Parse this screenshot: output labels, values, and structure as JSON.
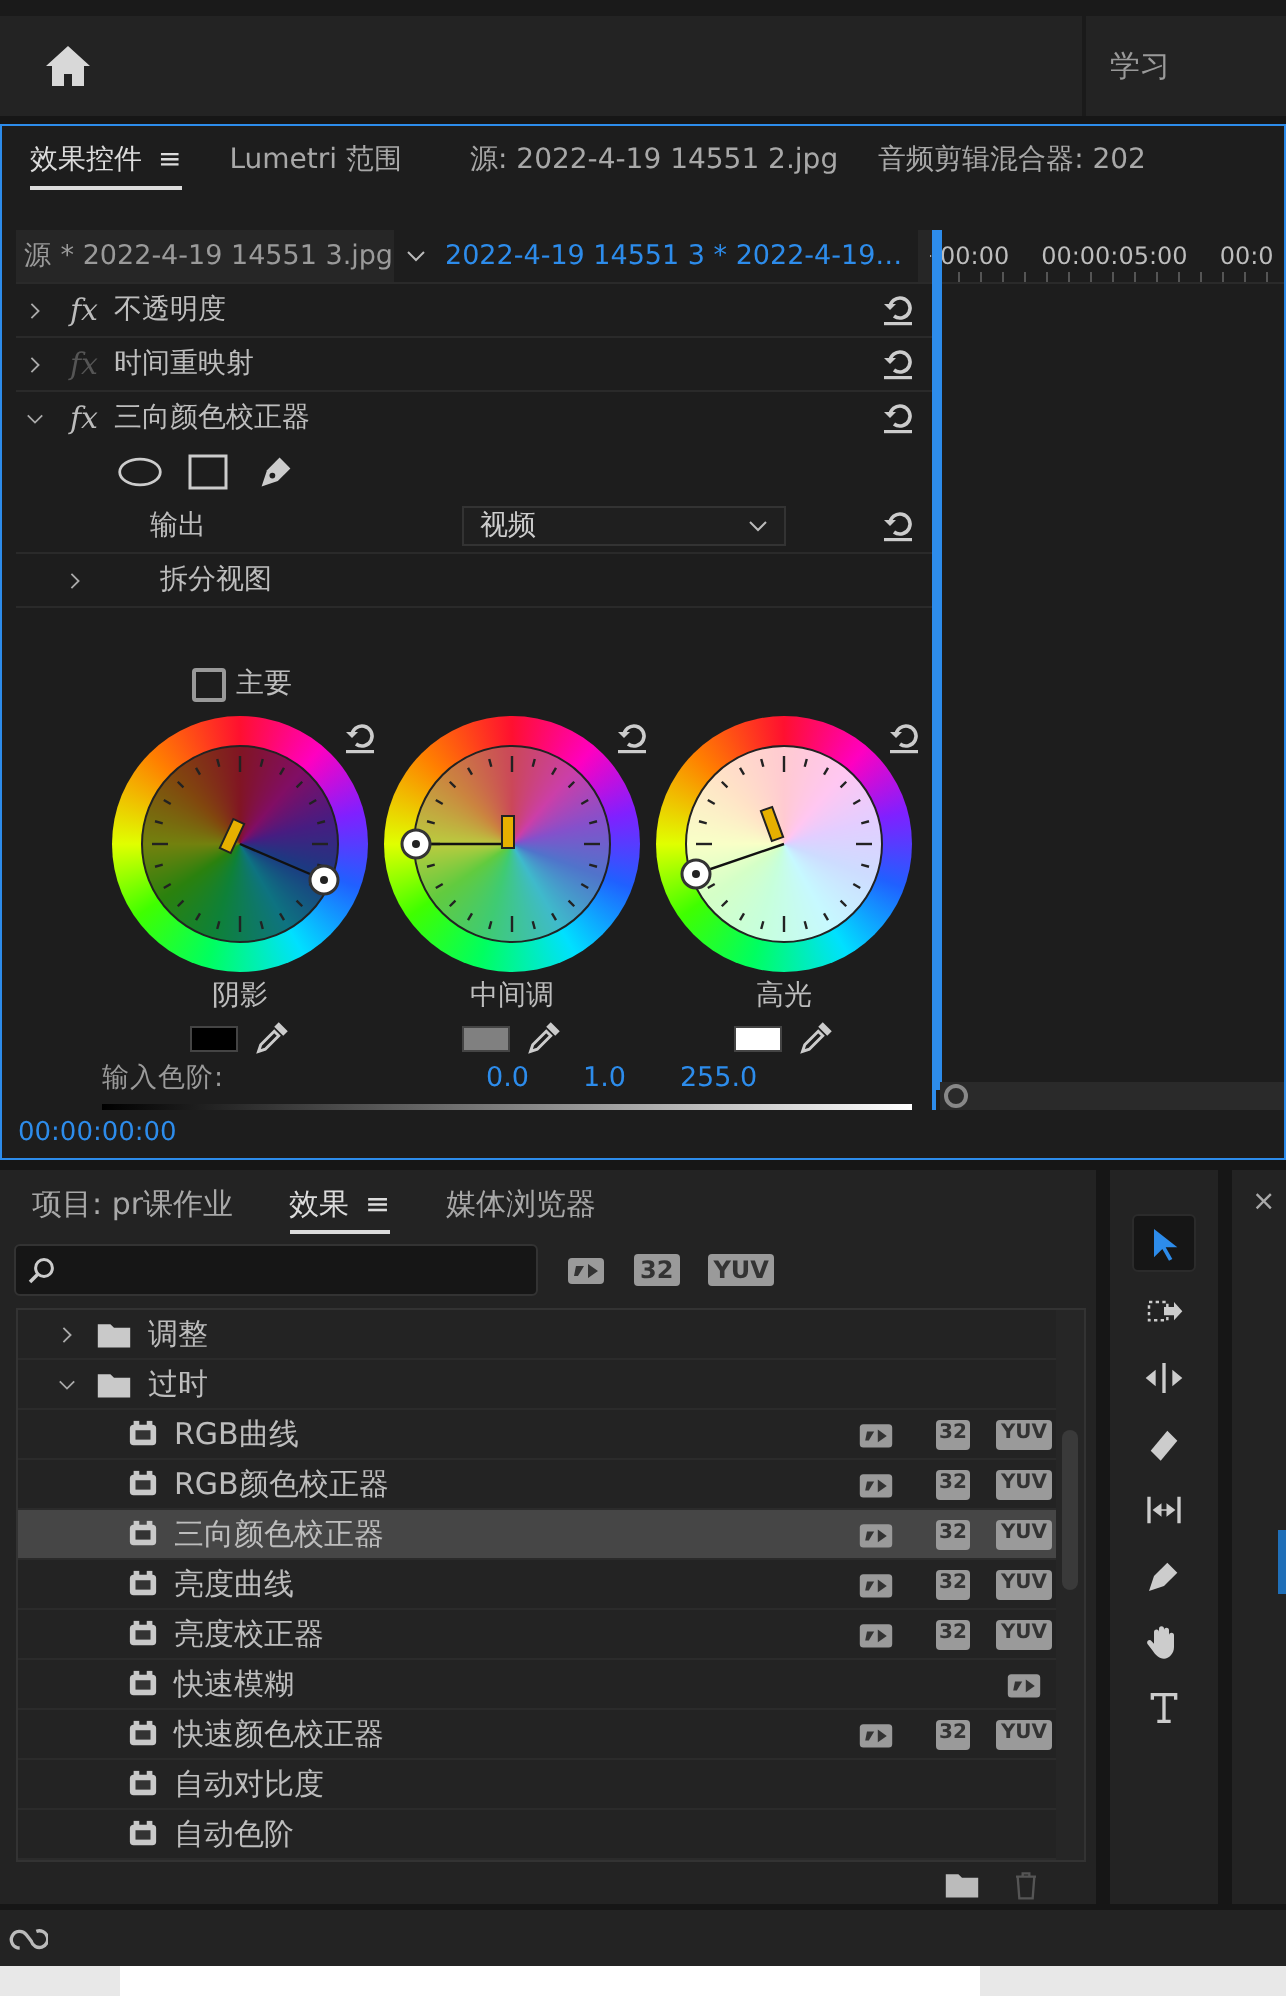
{
  "header": {
    "workspace": "学习"
  },
  "effect_controls": {
    "tabs": [
      {
        "label": "效果控件",
        "selected": true,
        "menu": "≡"
      },
      {
        "label": "Lumetri 范围",
        "selected": false
      },
      {
        "label": "源: 2022-4-19 14551 2.jpg",
        "selected": false
      },
      {
        "label": "音频剪辑混合器: 202",
        "selected": false
      }
    ],
    "source": "源 * 2022-4-19 14551 3.jpg",
    "clip": "2022-4-19 14551 3 * 2022-4-19…",
    "ruler": [
      "00:00",
      "00:00:05:00",
      "00:0"
    ],
    "effects": [
      {
        "toggle": "fx",
        "name": "不透明度",
        "expanded": false,
        "disabled": false
      },
      {
        "toggle": "fx",
        "name": "时间重映射",
        "expanded": false,
        "disabled": true
      },
      {
        "toggle": "fx",
        "name": "三向颜色校正器",
        "expanded": true,
        "disabled": false
      }
    ],
    "output": {
      "label": "输出",
      "value": "视频"
    },
    "split_view": {
      "label": "拆分视图",
      "expanded": false
    },
    "master": {
      "label": "主要",
      "checked": false
    },
    "wheels": [
      {
        "kind": "shadow",
        "label": "阴影",
        "color": "#000000"
      },
      {
        "kind": "midtone",
        "label": "中间调",
        "color": "#808080"
      },
      {
        "kind": "highlight",
        "label": "高光",
        "color": "#ffffff"
      }
    ],
    "input_levels": {
      "label": "输入色阶:",
      "values": [
        "0.0",
        "1.0",
        "255.0"
      ]
    },
    "timecode": "00:00:00:00"
  },
  "effects_panel": {
    "tabs": [
      {
        "label": "项目: pr课作业",
        "selected": false
      },
      {
        "label": "效果",
        "selected": true,
        "menu": "≡"
      },
      {
        "label": "媒体浏览器",
        "selected": false
      }
    ],
    "filter_badges": [
      "32",
      "YUV"
    ],
    "tree": [
      {
        "name": "调整",
        "expanded": false
      },
      {
        "name": "过时",
        "expanded": true,
        "children": [
          {
            "name": "RGB曲线",
            "selected": false,
            "accelerated": true,
            "badges": [
              "32",
              "YUV"
            ]
          },
          {
            "name": "RGB颜色校正器",
            "selected": false,
            "accelerated": true,
            "badges": [
              "32",
              "YUV"
            ]
          },
          {
            "name": "三向颜色校正器",
            "selected": true,
            "accelerated": true,
            "badges": [
              "32",
              "YUV"
            ]
          },
          {
            "name": "亮度曲线",
            "selected": false,
            "accelerated": true,
            "badges": [
              "32",
              "YUV"
            ]
          },
          {
            "name": "亮度校正器",
            "selected": false,
            "accelerated": true,
            "badges": [
              "32",
              "YUV"
            ]
          },
          {
            "name": "快速模糊",
            "selected": false,
            "accelerated": true
          },
          {
            "name": "快速颜色校正器",
            "selected": false,
            "accelerated": true,
            "badges": [
              "32",
              "YUV"
            ]
          },
          {
            "name": "自动对比度",
            "selected": false,
            "accelerated": false
          },
          {
            "name": "自动色阶",
            "selected": false,
            "accelerated": false
          }
        ]
      }
    ]
  },
  "tools": [
    {
      "kind": "selection",
      "selected": true
    },
    {
      "kind": "track-select",
      "selected": false
    },
    {
      "kind": "ripple",
      "selected": false
    },
    {
      "kind": "razor",
      "selected": false
    },
    {
      "kind": "slip",
      "selected": false
    },
    {
      "kind": "pen",
      "selected": false
    },
    {
      "kind": "hand",
      "selected": false
    },
    {
      "kind": "type",
      "selected": false
    }
  ],
  "side_panel": {
    "close": "×"
  }
}
